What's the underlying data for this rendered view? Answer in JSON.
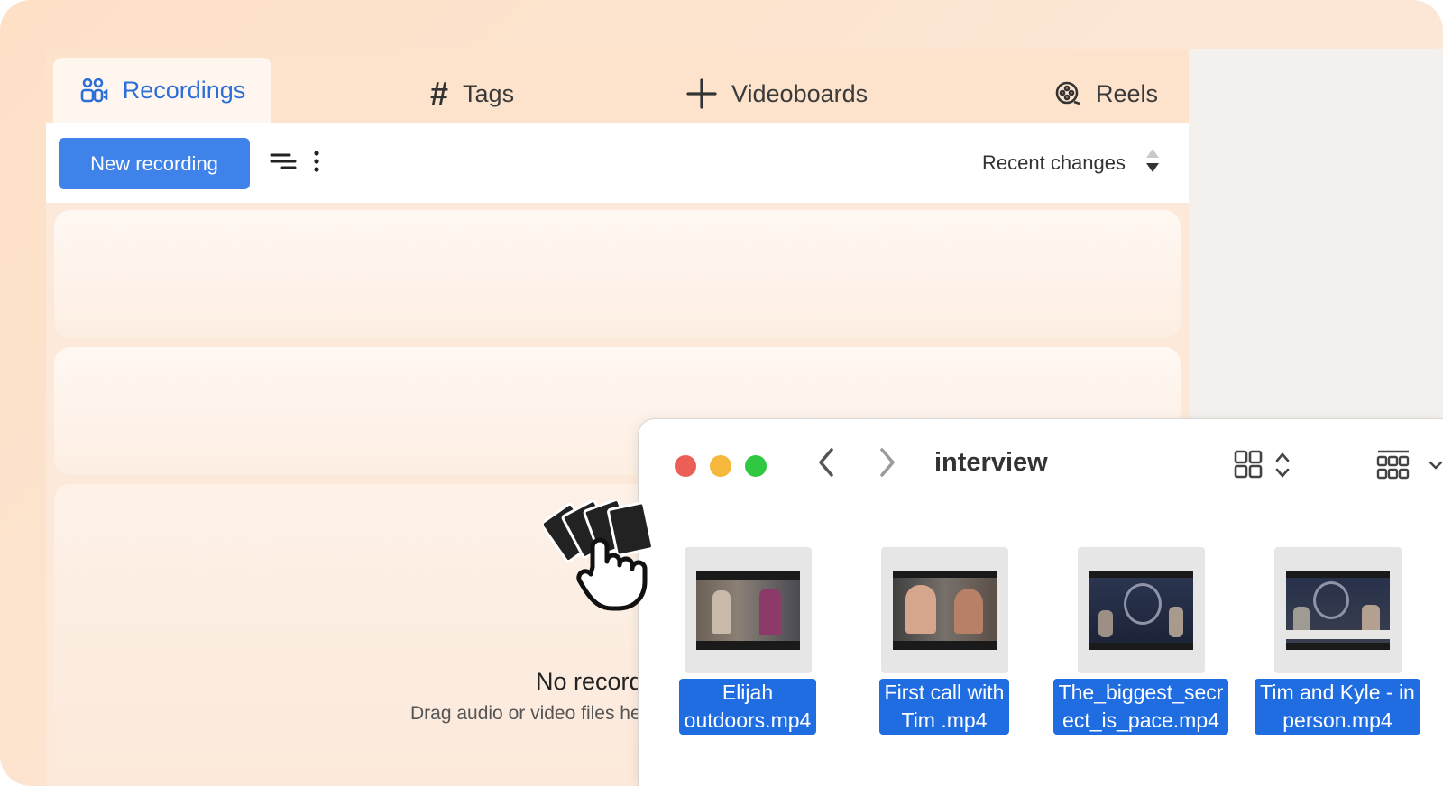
{
  "tabs": [
    {
      "label": "Recordings",
      "icon": "people-icon",
      "active": true
    },
    {
      "label": "Tags",
      "icon": "hash-icon",
      "active": false
    },
    {
      "label": "Videoboards",
      "icon": "plus-icon",
      "active": false
    },
    {
      "label": "Reels",
      "icon": "reel-icon",
      "active": false
    }
  ],
  "toolbar": {
    "new_recording_label": "New recording",
    "sort_label": "Recent changes"
  },
  "empty_state": {
    "title": "No recordings",
    "subtitle": "Drag audio or video files here"
  },
  "finder": {
    "folder": "interview",
    "files": [
      {
        "name_line1": "Elijah",
        "name_line2": "outdoors.mp4"
      },
      {
        "name_line1": "First call with",
        "name_line2": "Tim .mp4"
      },
      {
        "name_line1": "The_biggest_secr",
        "name_line2": "ect_is_pace.mp4"
      },
      {
        "name_line1": "Tim and Kyle - in",
        "name_line2": "person.mp4"
      }
    ]
  },
  "colors": {
    "accent": "#3f82ea",
    "active_tab_text": "#2d6fd8",
    "selection": "#1f6de1",
    "close": "#ec5f57",
    "minimize": "#f5b73c",
    "zoom": "#2fc840"
  }
}
